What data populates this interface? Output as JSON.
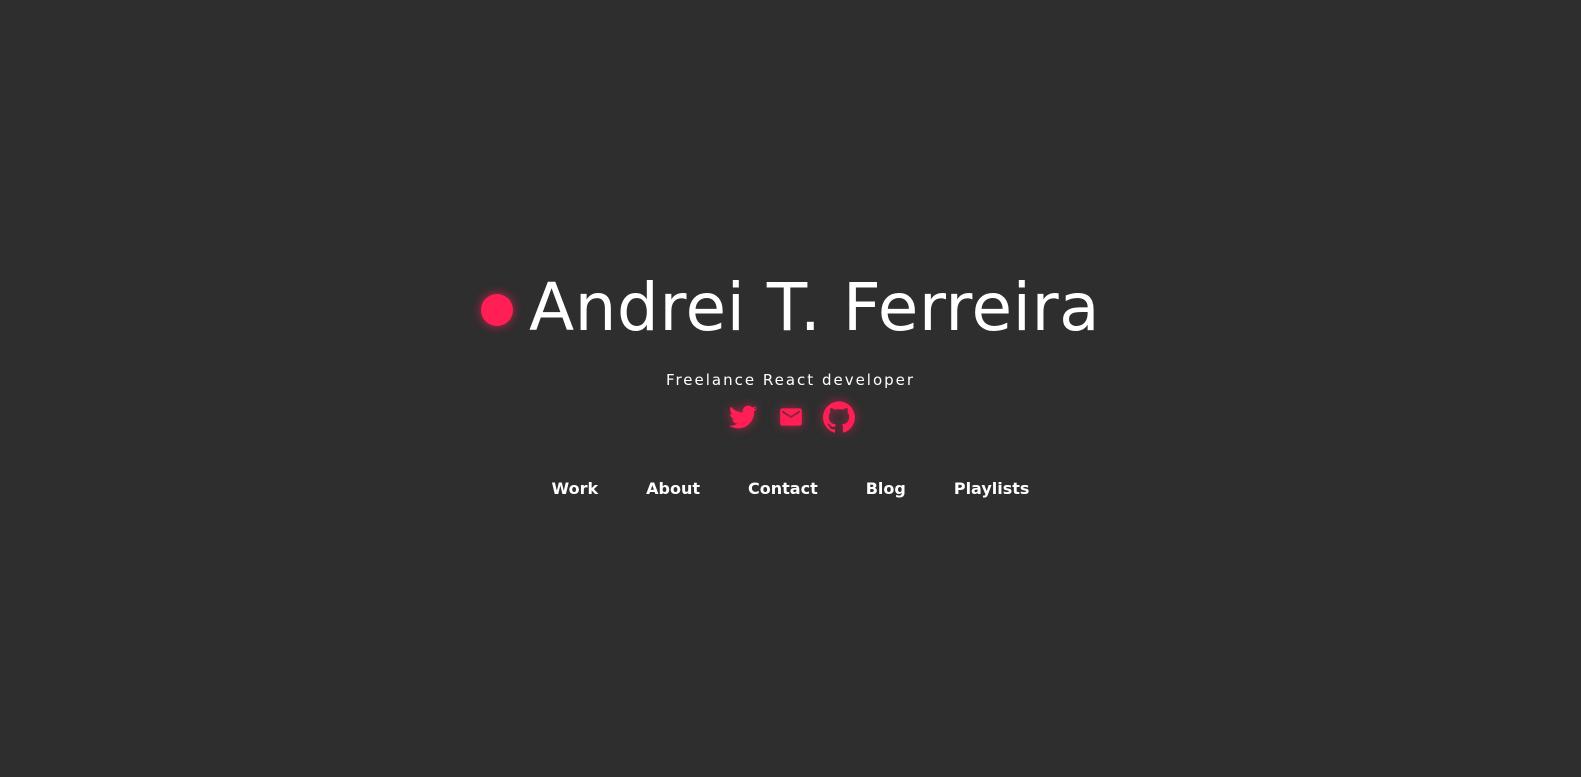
{
  "hero": {
    "name": "Andrei T. Ferreira",
    "subtitle": "Freelance React developer"
  },
  "social": [
    {
      "name": "twitter-icon",
      "label": "Twitter"
    },
    {
      "name": "mail-icon",
      "label": "Email"
    },
    {
      "name": "github-icon",
      "label": "GitHub"
    }
  ],
  "nav": {
    "items": [
      {
        "label": "Work"
      },
      {
        "label": "About"
      },
      {
        "label": "Contact"
      },
      {
        "label": "Blog"
      },
      {
        "label": "Playlists"
      }
    ]
  },
  "colors": {
    "background": "#2e2e2e",
    "accent": "#ff1f55",
    "text": "#ffffff"
  }
}
